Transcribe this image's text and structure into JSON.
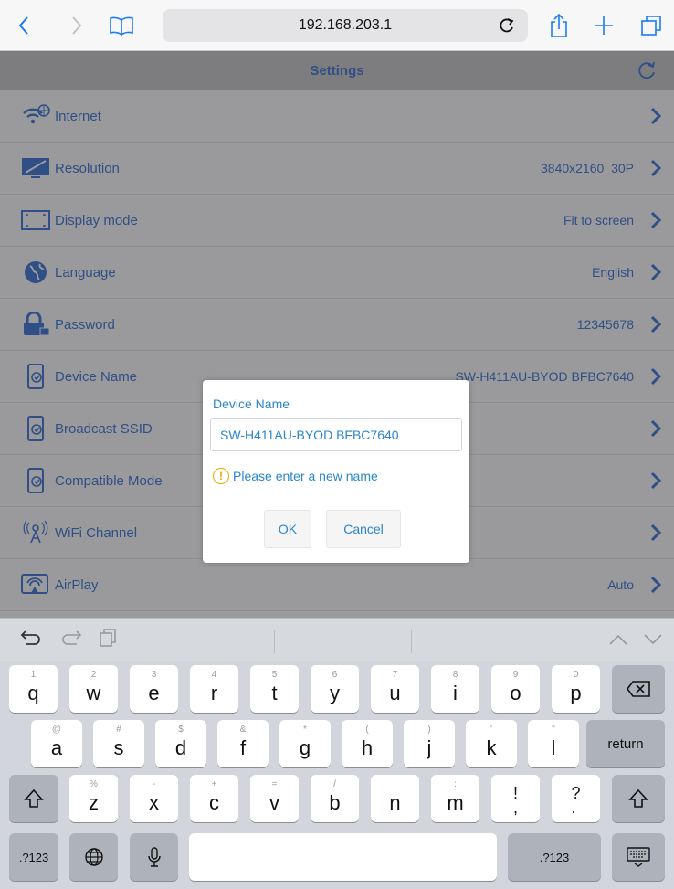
{
  "browser": {
    "url": "192.168.203.1",
    "reload_icon": "reload-icon",
    "nav_back": "back-chevron-icon",
    "nav_forward": "forward-chevron-icon",
    "bookmarks": "book-icon",
    "share": "share-icon",
    "add": "plus-icon",
    "tabs": "tabs-icon"
  },
  "settings": {
    "title": "Settings",
    "rows": [
      {
        "label": "Internet",
        "value": "",
        "icon": "wifi-globe-icon"
      },
      {
        "label": "Resolution",
        "value": "3840x2160_30P",
        "icon": "monitor-icon"
      },
      {
        "label": "Display mode",
        "value": "Fit to screen",
        "icon": "fit-screen-icon"
      },
      {
        "label": "Language",
        "value": "English",
        "icon": "globe-icon"
      },
      {
        "label": "Password",
        "value": "12345678",
        "icon": "lock-icon"
      },
      {
        "label": "Device Name",
        "value": "SW-H411AU-BYOD BFBC7640",
        "icon": "device-icon"
      },
      {
        "label": "Broadcast SSID",
        "value": "",
        "icon": "device-icon"
      },
      {
        "label": "Compatible Mode",
        "value": "",
        "icon": "device-icon"
      },
      {
        "label": "WiFi Channel",
        "value": "",
        "icon": "wifi-person-icon"
      },
      {
        "label": "AirPlay",
        "value": "Auto",
        "icon": "airplay-icon"
      }
    ]
  },
  "dialog": {
    "title": "Device Name",
    "input_value": "SW-H411AU-BYOD BFBC7640",
    "warning": "Please enter a new name",
    "ok_label": "OK",
    "cancel_label": "Cancel",
    "warning_glyph": "!"
  },
  "keyboard": {
    "row1": [
      {
        "k": "q",
        "s": "1"
      },
      {
        "k": "w",
        "s": "2"
      },
      {
        "k": "e",
        "s": "3"
      },
      {
        "k": "r",
        "s": "4"
      },
      {
        "k": "t",
        "s": "5"
      },
      {
        "k": "y",
        "s": "6"
      },
      {
        "k": "u",
        "s": "7"
      },
      {
        "k": "i",
        "s": "8"
      },
      {
        "k": "o",
        "s": "9"
      },
      {
        "k": "p",
        "s": "0"
      }
    ],
    "row2": [
      {
        "k": "a",
        "s": "@"
      },
      {
        "k": "s",
        "s": "#"
      },
      {
        "k": "d",
        "s": "$"
      },
      {
        "k": "f",
        "s": "&"
      },
      {
        "k": "g",
        "s": "*"
      },
      {
        "k": "h",
        "s": "("
      },
      {
        "k": "j",
        "s": ")"
      },
      {
        "k": "k",
        "s": "'"
      },
      {
        "k": "l",
        "s": "\""
      }
    ],
    "row3": [
      {
        "k": "z",
        "s": "%"
      },
      {
        "k": "x",
        "s": "-"
      },
      {
        "k": "c",
        "s": "+"
      },
      {
        "k": "v",
        "s": "="
      },
      {
        "k": "b",
        "s": "/"
      },
      {
        "k": "n",
        "s": ";"
      },
      {
        "k": "m",
        "s": ":"
      },
      {
        "k": "!\n,",
        "s": ""
      },
      {
        "k": "?\n.",
        "s": ""
      }
    ],
    "return_label": "return",
    "numbers_label": ".?123",
    "numbers_label_right": ".?123"
  }
}
